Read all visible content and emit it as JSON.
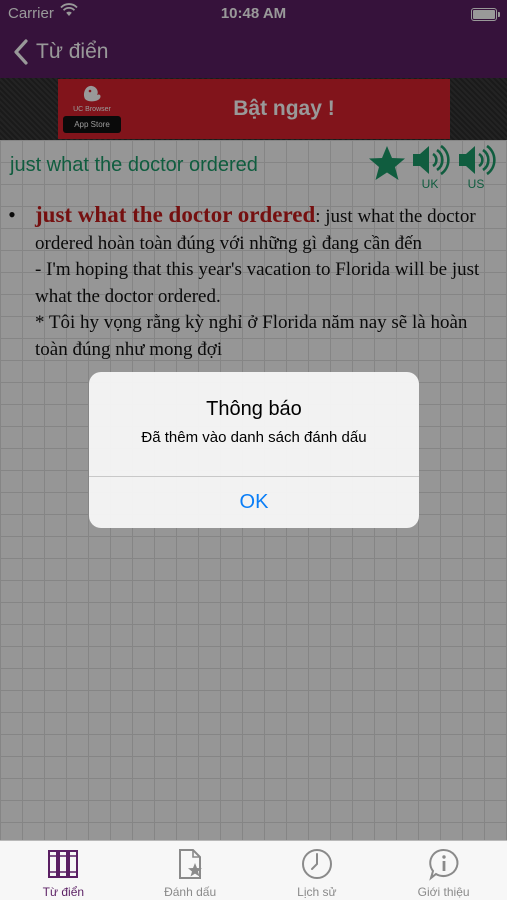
{
  "status_bar": {
    "carrier": "Carrier",
    "time": "10:48 AM"
  },
  "nav": {
    "back_label": "Từ điển"
  },
  "ad": {
    "brand": "UC Browser",
    "store_badge": "App Store",
    "cta": "Bật ngay !"
  },
  "colors": {
    "header": "#5a1f63",
    "accent": "#1c9b6a",
    "headword": "#c41b1b",
    "ad": "#d8222d",
    "link": "#0a7ef7"
  },
  "entry": {
    "word": "just what the doctor ordered",
    "pron_uk_label": "UK",
    "pron_us_label": "US",
    "headword": "just what the doctor ordered",
    "definition_text": ": just what the doctor ordered hoàn toàn đúng với những gì đang cần đến",
    "example_en": "- I'm hoping that this year's vacation to Florida will be just what the doctor ordered.",
    "example_vi": "* Tôi hy vọng rằng kỳ nghỉ ở Florida năm nay sẽ là hoàn toàn đúng như mong đợi"
  },
  "alert": {
    "title": "Thông báo",
    "message": "Đã thêm vào danh sách đánh dấu",
    "ok_label": "OK"
  },
  "tabs": [
    {
      "label": "Từ điển",
      "icon": "books-icon",
      "active": true
    },
    {
      "label": "Đánh dấu",
      "icon": "bookmark-doc-icon",
      "active": false
    },
    {
      "label": "Lịch sử",
      "icon": "clock-icon",
      "active": false
    },
    {
      "label": "Giới thiệu",
      "icon": "info-bubble-icon",
      "active": false
    }
  ]
}
